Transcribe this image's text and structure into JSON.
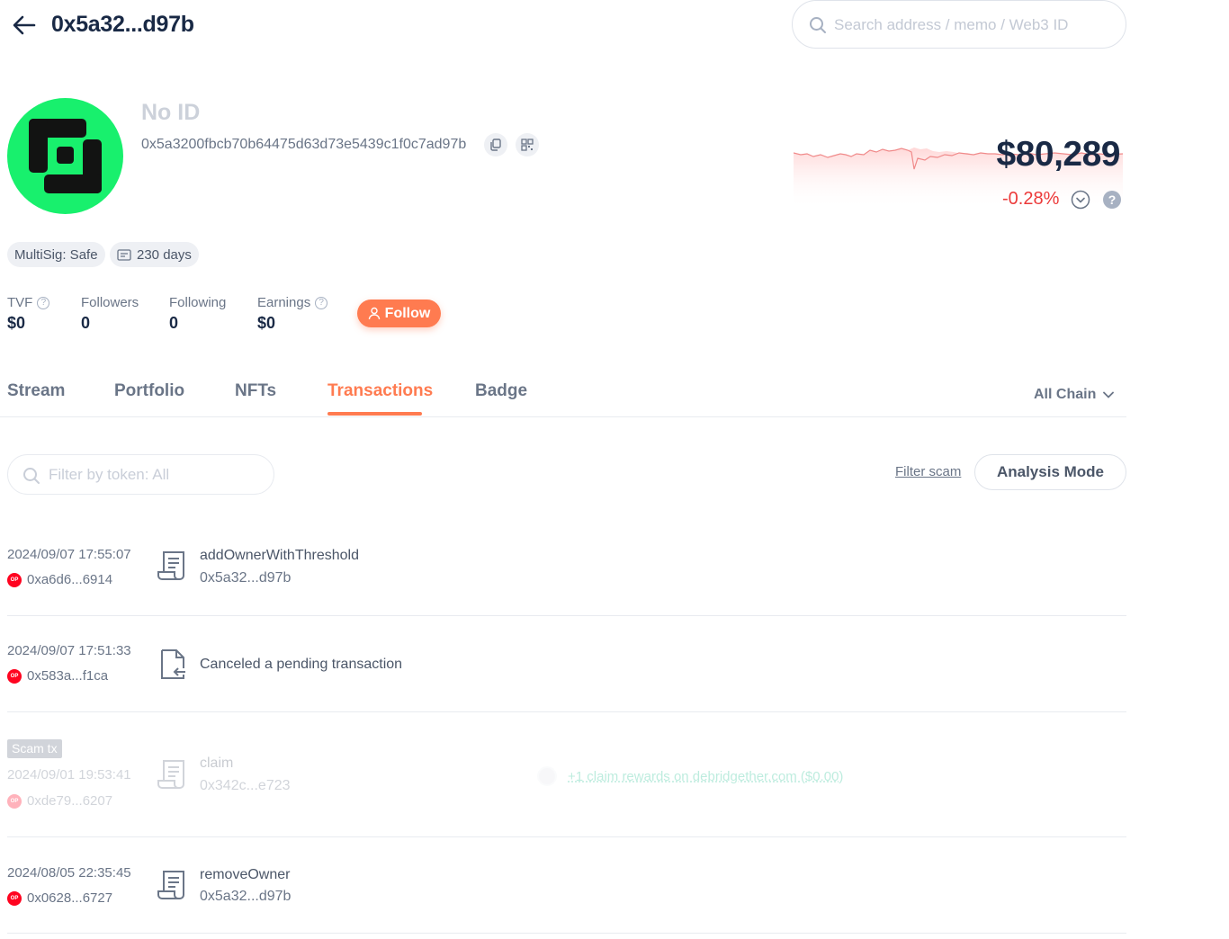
{
  "header": {
    "title": "0x5a32...d97b",
    "search_placeholder": "Search address / memo / Web3 ID"
  },
  "profile": {
    "name": "No ID",
    "address": "0x5a3200fbcb70b64475d63d73e5439c1f0c7ad97b",
    "balance": "$80,289",
    "change": "-0.28%",
    "help": "?",
    "tags": [
      "MultiSig: Safe",
      "230 days"
    ]
  },
  "stats": {
    "tvf_label": "TVF",
    "tvf_value": "$0",
    "followers_label": "Followers",
    "followers_value": "0",
    "following_label": "Following",
    "following_value": "0",
    "earnings_label": "Earnings",
    "earnings_value": "$0",
    "follow_button": "Follow"
  },
  "tabs": [
    "Stream",
    "Portfolio",
    "NFTs",
    "Transactions",
    "Badge"
  ],
  "active_tab": "Transactions",
  "chain_select": "All Chain",
  "filters": {
    "token_placeholder": "Filter by token: All",
    "filter_scam": "Filter scam",
    "analysis_mode": "Analysis Mode"
  },
  "chain_badge": "OP",
  "transactions": [
    {
      "time": "2024/09/07 17:55:07",
      "from": "0xa6d6...6914",
      "method": "addOwnerWithThreshold",
      "to": "0x5a32...d97b"
    },
    {
      "time": "2024/09/07 17:51:33",
      "from": "0x583a...f1ca",
      "method": "Canceled a pending transaction"
    },
    {
      "time": "2024/09/01 19:53:41",
      "from": "0xde79...6207",
      "method": "claim",
      "to": "0x342c...e723",
      "scam_label": "Scam tx",
      "token_change": "+1 claim rewards on debridgether.com ($0.00)"
    },
    {
      "time": "2024/08/05 22:35:45",
      "from": "0x0628...6727",
      "method": "removeOwner",
      "to": "0x5a32...d97b"
    }
  ],
  "colors": {
    "accent": "#ff7b50",
    "negative": "#ec3a3a",
    "avatar_bg": "#18f06d",
    "text_primary": "#192945",
    "text_secondary": "#6a7587"
  }
}
